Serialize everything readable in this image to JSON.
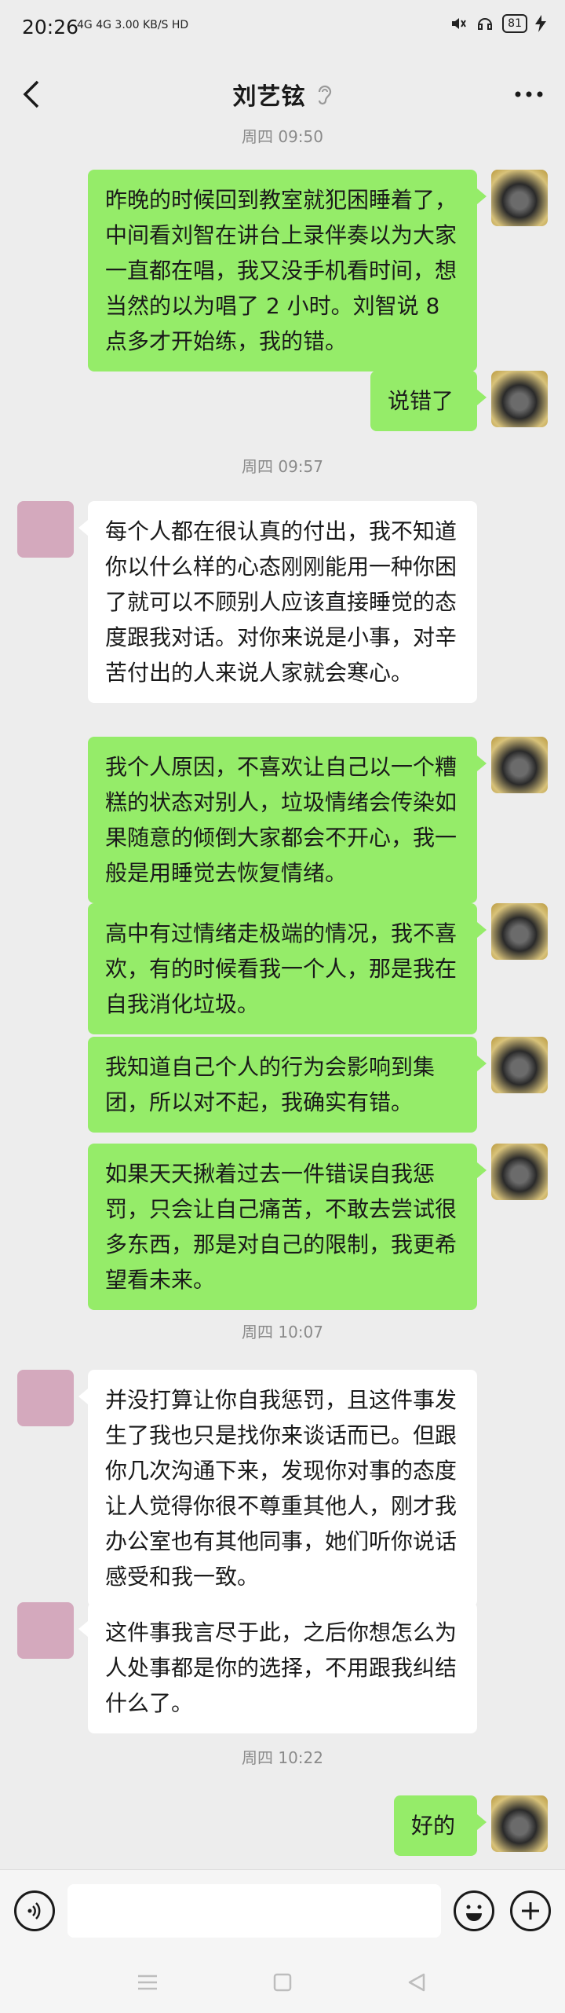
{
  "status_bar": {
    "time": "20:26",
    "network": "4G 4G 3.00 KB/S HD",
    "battery": "81"
  },
  "header": {
    "title": "刘艺铉"
  },
  "messages": [
    {
      "type": "timestamp",
      "text": "周四 09:50"
    },
    {
      "type": "me",
      "text": "昨晚的时候回到教室就犯困睡着了，中间看刘智在讲台上录伴奏以为大家一直都在唱，我又没手机看时间，想当然的以为唱了 2 小时。刘智说 8 点多才开始练，我的错。"
    },
    {
      "type": "me",
      "text": "说错了"
    },
    {
      "type": "timestamp",
      "text": "周四 09:57"
    },
    {
      "type": "other",
      "text": "每个人都在很认真的付出，我不知道你以什么样的心态刚刚能用一种你困了就可以不顾别人应该直接睡觉的态度跟我对话。对你来说是小事，对辛苦付出的人来说人家就会寒心。"
    },
    {
      "type": "me",
      "text": "我个人原因，不喜欢让自己以一个糟糕的状态对别人，垃圾情绪会传染如果随意的倾倒大家都会不开心，我一般是用睡觉去恢复情绪。"
    },
    {
      "type": "me",
      "text": "高中有过情绪走极端的情况，我不喜欢，有的时候看我一个人，那是我在自我消化垃圾。"
    },
    {
      "type": "me",
      "text": "我知道自己个人的行为会影响到集团，所以对不起，我确实有错。"
    },
    {
      "type": "me",
      "text": "如果天天揪着过去一件错误自我惩罚，只会让自己痛苦，不敢去尝试很多东西，那是对自己的限制，我更希望看未来。"
    },
    {
      "type": "timestamp",
      "text": "周四 10:07"
    },
    {
      "type": "other",
      "text": "并没打算让你自我惩罚，且这件事发生了我也只是找你来谈话而已。但跟你几次沟通下来，发现你对事的态度让人觉得你很不尊重其他人，刚才我办公室也有其他同事，她们听你说话感受和我一致。"
    },
    {
      "type": "other",
      "text": "这件事我言尽于此，之后你想怎么为人处事都是你的选择，不用跟我纠结什么了。"
    },
    {
      "type": "timestamp",
      "text": "周四 10:22"
    },
    {
      "type": "me",
      "text": "好的"
    }
  ],
  "input": {
    "placeholder": ""
  },
  "icons": {
    "back": "back-arrow-icon",
    "more": "more-dots-icon",
    "voice": "voice-icon",
    "emoji": "emoji-icon",
    "plus": "plus-icon",
    "ear": "ear-icon"
  }
}
